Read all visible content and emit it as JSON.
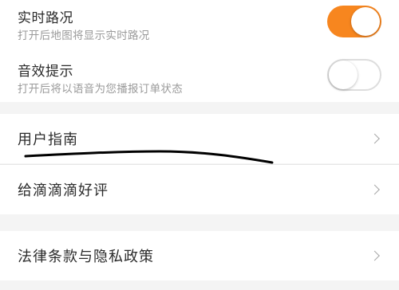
{
  "settings": {
    "realtime_traffic": {
      "title": "实时路况",
      "subtitle": "打开后地图将显示实时路况",
      "enabled": true
    },
    "sound_effects": {
      "title": "音效提示",
      "subtitle": "打开后将以语音为您播报订单状态",
      "enabled": false
    }
  },
  "menu": {
    "user_guide": "用户指南",
    "rate_app": "给滴滴滴好评",
    "legal_privacy": "法律条款与隐私政策"
  },
  "colors": {
    "accent": "#f7861f",
    "page_background": "#f4f4f4",
    "handwritten_mark": "#000000"
  },
  "icons": {
    "chevron": "chevron-right-icon"
  }
}
